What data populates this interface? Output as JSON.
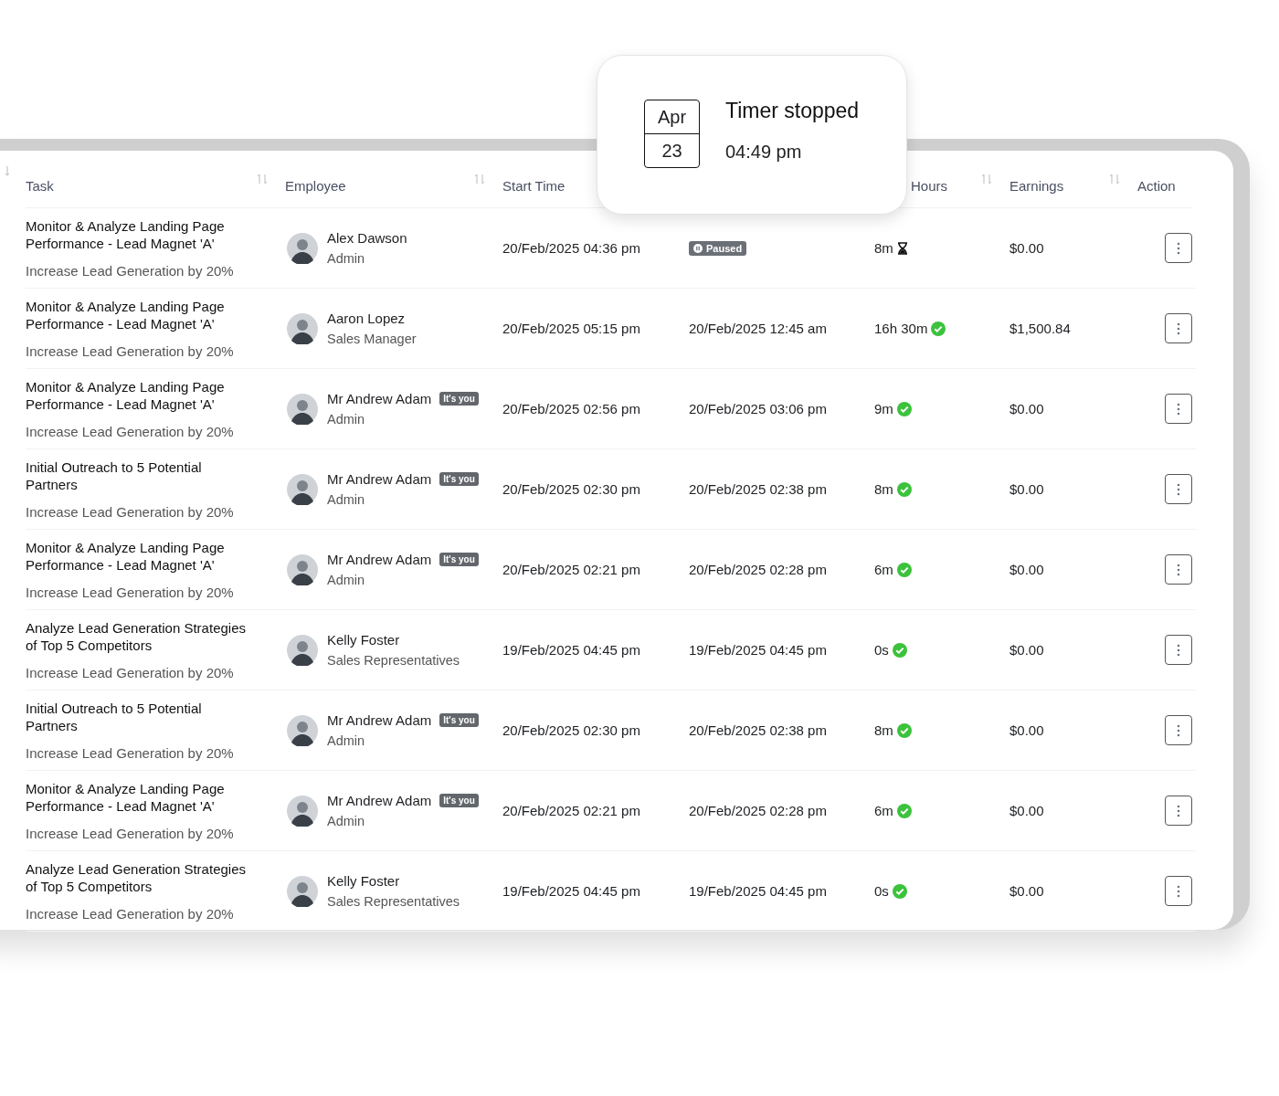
{
  "toast": {
    "month": "Apr",
    "day": "23",
    "title": "Timer stopped",
    "time": "04:49 pm"
  },
  "headers": {
    "task": {
      "label": "Task",
      "sortable": true
    },
    "employee": {
      "label": "Employee",
      "sortable": true
    },
    "start_time": {
      "label": "Start Time"
    },
    "hours": {
      "label": "Hours",
      "sortable": true
    },
    "earnings": {
      "label": "Earnings",
      "sortable": true
    },
    "action": {
      "label": "Action"
    }
  },
  "rows": [
    {
      "task": "Monitor & Analyze Landing Page Performance - Lead Magnet 'A'",
      "goal": "Increase Lead Generation by 20%",
      "employee": {
        "name": "Alex Dawson",
        "role": "Admin"
      },
      "start": "20/Feb/2025 04:36 pm",
      "end": {
        "kind": "badge",
        "text": "Paused"
      },
      "hours": {
        "text": "8m",
        "running": true
      },
      "earnings": "$0.00"
    },
    {
      "task": "Monitor & Analyze Landing Page Performance - Lead Magnet 'A'",
      "goal": "Increase Lead Generation by 20%",
      "employee": {
        "name": "Aaron Lopez",
        "role": "Sales Manager"
      },
      "start": "20/Feb/2025 05:15 pm",
      "end": {
        "kind": "time",
        "text": "20/Feb/2025 12:45 am"
      },
      "hours": {
        "text": "16h 30m",
        "running": false
      },
      "earnings": "$1,500.84"
    },
    {
      "task": "Monitor & Analyze Landing Page Performance - Lead Magnet 'A'",
      "goal": "Increase Lead Generation by 20%",
      "employee": {
        "name": "Mr Andrew Adam",
        "badge": "It's you",
        "role": "Admin"
      },
      "start": "20/Feb/2025 02:56 pm",
      "end": {
        "kind": "time",
        "text": "20/Feb/2025 03:06 pm"
      },
      "hours": {
        "text": "9m",
        "running": false
      },
      "earnings": "$0.00"
    },
    {
      "task": "Initial Outreach to 5 Potential Partners",
      "goal": "Increase Lead Generation by 20%",
      "employee": {
        "name": "Mr Andrew Adam",
        "badge": "It's you",
        "role": "Admin"
      },
      "start": "20/Feb/2025 02:30 pm",
      "end": {
        "kind": "time",
        "text": "20/Feb/2025 02:38 pm"
      },
      "hours": {
        "text": "8m",
        "running": false
      },
      "earnings": "$0.00"
    },
    {
      "task": "Monitor & Analyze Landing Page Performance - Lead Magnet 'A'",
      "goal": "Increase Lead Generation by 20%",
      "employee": {
        "name": "Mr Andrew Adam",
        "badge": "It's you",
        "role": "Admin"
      },
      "start": "20/Feb/2025 02:21 pm",
      "end": {
        "kind": "time",
        "text": "20/Feb/2025 02:28 pm"
      },
      "hours": {
        "text": "6m",
        "running": false
      },
      "earnings": "$0.00"
    },
    {
      "task": "Analyze Lead Generation Strategies of Top 5 Competitors",
      "goal": "Increase Lead Generation by 20%",
      "employee": {
        "name": "Kelly Foster",
        "role": "Sales Representatives"
      },
      "start": "19/Feb/2025 04:45 pm",
      "end": {
        "kind": "time",
        "text": "19/Feb/2025 04:45 pm"
      },
      "hours": {
        "text": "0s",
        "running": false
      },
      "earnings": "$0.00"
    },
    {
      "task": "Initial Outreach to 5 Potential Partners",
      "goal": "Increase Lead Generation by 20%",
      "employee": {
        "name": "Mr Andrew Adam",
        "badge": "It's you",
        "role": "Admin"
      },
      "start": "20/Feb/2025 02:30 pm",
      "end": {
        "kind": "time",
        "text": "20/Feb/2025 02:38 pm"
      },
      "hours": {
        "text": "8m",
        "running": false
      },
      "earnings": "$0.00"
    },
    {
      "task": "Monitor & Analyze Landing Page Performance - Lead Magnet 'A'",
      "goal": "Increase Lead Generation by 20%",
      "employee": {
        "name": "Mr Andrew Adam",
        "badge": "It's you",
        "role": "Admin"
      },
      "start": "20/Feb/2025 02:21 pm",
      "end": {
        "kind": "time",
        "text": "20/Feb/2025 02:28 pm"
      },
      "hours": {
        "text": "6m",
        "running": false
      },
      "earnings": "$0.00"
    },
    {
      "task": "Analyze Lead Generation Strategies of Top 5 Competitors",
      "goal": "Increase Lead Generation by 20%",
      "employee": {
        "name": "Kelly Foster",
        "role": "Sales Representatives"
      },
      "start": "19/Feb/2025 04:45 pm",
      "end": {
        "kind": "time",
        "text": "19/Feb/2025 04:45 pm"
      },
      "hours": {
        "text": "0s",
        "running": false
      },
      "earnings": "$0.00"
    }
  ]
}
